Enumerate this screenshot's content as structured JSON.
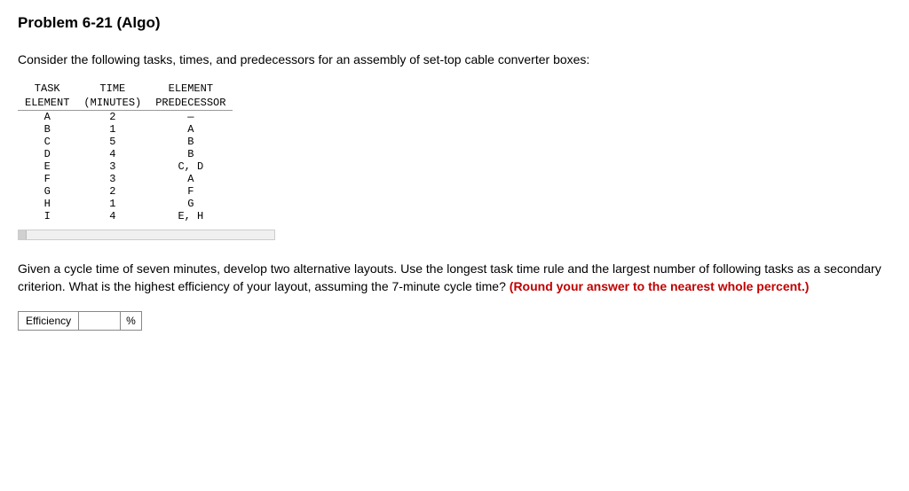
{
  "title": "Problem 6-21 (Algo)",
  "intro": "Consider the following tasks, times, and predecessors for an assembly of set-top cable converter boxes:",
  "table": {
    "header1": {
      "c1": "TASK",
      "c2": "TIME",
      "c3": "ELEMENT"
    },
    "header2": {
      "c1": "ELEMENT",
      "c2": "(MINUTES)",
      "c3": "PREDECESSOR"
    },
    "rows": [
      {
        "element": "A",
        "time": "2",
        "pred": "—"
      },
      {
        "element": "B",
        "time": "1",
        "pred": "A"
      },
      {
        "element": "C",
        "time": "5",
        "pred": "B"
      },
      {
        "element": "D",
        "time": "4",
        "pred": "B"
      },
      {
        "element": "E",
        "time": "3",
        "pred": "C, D"
      },
      {
        "element": "F",
        "time": "3",
        "pred": "A"
      },
      {
        "element": "G",
        "time": "2",
        "pred": "F"
      },
      {
        "element": "H",
        "time": "1",
        "pred": "G"
      },
      {
        "element": "I",
        "time": "4",
        "pred": "E, H"
      }
    ]
  },
  "question": {
    "part1": "Given a cycle time of seven minutes, develop two alternative layouts. Use the longest task time rule and the largest number of following tasks as a secondary criterion. What is the highest efficiency of your layout, assuming the 7-minute cycle time? ",
    "part2_bold_red": "(Round your answer to the nearest whole percent.)"
  },
  "answer": {
    "label": "Efficiency",
    "value": "",
    "unit": "%"
  }
}
